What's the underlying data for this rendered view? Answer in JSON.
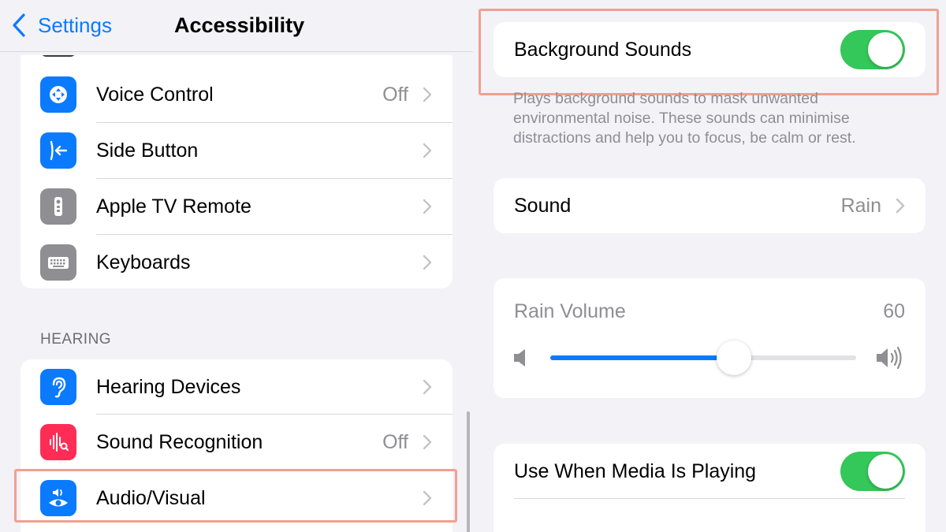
{
  "left": {
    "nav": {
      "back_label": "Settings",
      "title": "Accessibility"
    },
    "group1": [
      {
        "label": "Voice Control",
        "value": "Off",
        "icon": "voice-control-icon",
        "color": "#0a7aff"
      },
      {
        "label": "Side Button",
        "value": "",
        "icon": "side-button-icon",
        "color": "#0a7aff"
      },
      {
        "label": "Apple TV Remote",
        "value": "",
        "icon": "tv-remote-icon",
        "color": "#8e8e93"
      },
      {
        "label": "Keyboards",
        "value": "",
        "icon": "keyboard-icon",
        "color": "#8e8e93"
      }
    ],
    "section_hearing": "HEARING",
    "group2": [
      {
        "label": "Hearing Devices",
        "value": "",
        "icon": "ear-icon",
        "color": "#0a7aff"
      },
      {
        "label": "Sound Recognition",
        "value": "Off",
        "icon": "sound-recognition-icon",
        "color": "#ff2d55"
      },
      {
        "label": "Audio/Visual",
        "value": "",
        "icon": "audio-visual-icon",
        "color": "#0a7aff"
      }
    ]
  },
  "right": {
    "background_sounds": {
      "label": "Background Sounds",
      "on": true
    },
    "description": "Plays background sounds to mask unwanted environmental noise. These sounds can minimise distractions and help you to focus, be calm or rest.",
    "sound": {
      "label": "Sound",
      "value": "Rain"
    },
    "volume": {
      "label": "Rain Volume",
      "value": "60",
      "level": 0.6
    },
    "media": {
      "label": "Use When Media Is Playing",
      "on": true
    }
  },
  "colors": {
    "accent": "#0a7aff",
    "toggle_on": "#34c759",
    "highlight": "#f0a090"
  }
}
